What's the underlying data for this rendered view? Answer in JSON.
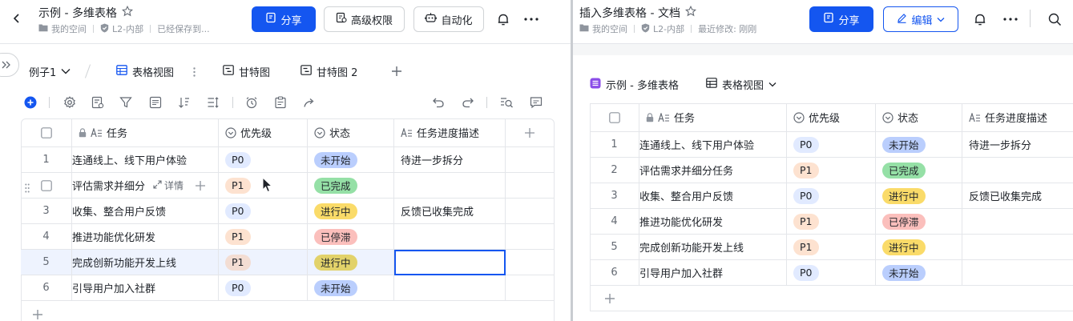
{
  "left": {
    "title": "示例 - 多维表格",
    "breadcrumb": {
      "space": "我的空间",
      "level": "L2-内部",
      "save_status": "已经保存到..."
    },
    "share_label": "分享",
    "permission_label": "高级权限",
    "automation_label": "自动化",
    "table_name": "例子1",
    "tabs": [
      {
        "label": "表格视图",
        "icon": "grid-icon",
        "active": true
      },
      {
        "label": "甘特图",
        "icon": "gantt-icon",
        "active": false
      },
      {
        "label": "甘特图 2",
        "icon": "gantt-icon",
        "active": false
      }
    ],
    "columns": {
      "task": "任务",
      "priority": "优先级",
      "status": "状态",
      "progress": "任务进度描述"
    },
    "row_detail_label": "详情",
    "rows": [
      {
        "n": "1",
        "task": "连通线上、线下用户体验",
        "priority": "P0",
        "status": "未开始",
        "progress": "待进一步拆分"
      },
      {
        "n": "2",
        "task": "评估需求并细分",
        "priority": "P1",
        "status": "已完成",
        "progress": ""
      },
      {
        "n": "3",
        "task": "收集、整合用户反馈",
        "priority": "P0",
        "status": "进行中",
        "progress": "反馈已收集完成"
      },
      {
        "n": "4",
        "task": "推进功能优化研发",
        "priority": "P1",
        "status": "已停滞",
        "progress": ""
      },
      {
        "n": "5",
        "task": "完成创新功能开发上线",
        "priority": "P1",
        "status": "进行中",
        "progress": ""
      },
      {
        "n": "6",
        "task": "引导用户加入社群",
        "priority": "P0",
        "status": "未开始",
        "progress": ""
      }
    ]
  },
  "right": {
    "title": "插入多维表格 - 文档",
    "breadcrumb": {
      "space": "我的空间",
      "level": "L2-内部",
      "modified": "最近修改: 刚刚"
    },
    "share_label": "分享",
    "edit_label": "编辑",
    "embed_name": "示例 - 多维表格",
    "embed_view": "表格视图",
    "columns": {
      "task": "任务",
      "priority": "优先级",
      "status": "状态",
      "progress": "任务进度描述"
    },
    "rows": [
      {
        "n": "1",
        "task": "连通线上、线下用户体验",
        "priority": "P0",
        "status": "未开始",
        "progress": "待进一步拆分"
      },
      {
        "n": "2",
        "task": "评估需求并细分任务",
        "priority": "P1",
        "status": "已完成",
        "progress": ""
      },
      {
        "n": "3",
        "task": "收集、整合用户反馈",
        "priority": "P0",
        "status": "进行中",
        "progress": "反馈已收集完成"
      },
      {
        "n": "4",
        "task": "推进功能优化研发",
        "priority": "P1",
        "status": "已停滞",
        "progress": ""
      },
      {
        "n": "5",
        "task": "完成创新功能开发上线",
        "priority": "P1",
        "status": "进行中",
        "progress": ""
      },
      {
        "n": "6",
        "task": "引导用户加入社群",
        "priority": "P0",
        "status": "未开始",
        "progress": ""
      }
    ]
  },
  "colors": {
    "accent": "#1456f0",
    "p0_bg": "#e1eaff",
    "p1_bg": "#fde2d0",
    "status_bg": {
      "未开始": "#bacefd",
      "已完成": "#95e0a6",
      "进行中": "#fadb69",
      "已停滞": "#fbbfbc"
    },
    "status_bg_highlight": {
      "进行中": "#e2d26a"
    },
    "p1_bg_highlight": "#f3ddd3"
  }
}
